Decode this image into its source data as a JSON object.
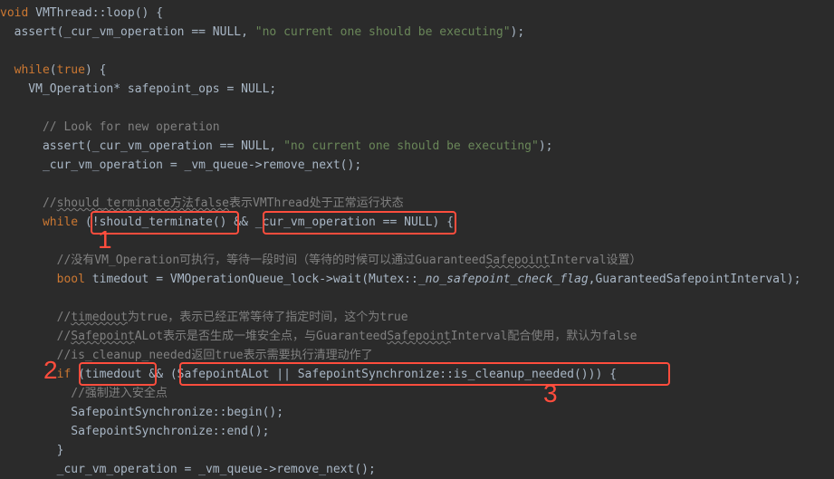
{
  "code": {
    "l0_void": "void",
    "l0_sig": " VMThread::loop() {",
    "l1_a": "  assert(_cur_vm_operation == NULL, ",
    "l1_str": "\"no current one should be executing\"",
    "l1_b": ");",
    "l2": "",
    "l3_while": "while",
    "l3_rest": "(",
    "l3_true": "true",
    "l3_end": ") {",
    "l4_a": "    VM_Operation* ",
    "l4_b": "safepoint_ops",
    "l4_c": " = NULL;",
    "l5": "",
    "l6_cm": "      // Look for new operation",
    "l7_a": "      assert(_cur_vm_operation == NULL, ",
    "l7_str": "\"no current one should be executing\"",
    "l7_b": ");",
    "l8": "      _cur_vm_operation = _vm_queue->remove_next();",
    "l9": "",
    "l10_cm_a": "      //",
    "l10_cm_us": "should_terminate方法false",
    "l10_cm_b": "表示VMThread处于正常运行状态",
    "l11_while": "while",
    "l11_a": " (!should_terminate() && _cur_vm_operation == NULL) {",
    "l12": "",
    "l13_cm": "        //没有VM_Operation可执行，等待一段时间（等待的时候可以通过Guaranteed",
    "l13_cm_us": "Safepoint",
    "l13_cm_b": "Interval设置）",
    "l14_bool": "bool",
    "l14_a": " ",
    "l14_v": "timedout",
    "l14_b": " = VMOperationQueue_lock->wait(Mutex::",
    "l14_i": "_no_safepoint_check_flag",
    "l14_c": ",GuaranteedSafepointInterval);",
    "l15": "",
    "l16_cm_a": "        //",
    "l16_cm_us": "timedout",
    "l16_cm_b": "为true，表示已经正常等待了指定时间，这个为true",
    "l17_cm_a": "        //",
    "l17_cm_us1": "Safepoint",
    "l17_cm_mid": "ALot表示是否生成一堆安全点，与Guaranteed",
    "l17_cm_us2": "Safepoint",
    "l17_cm_b": "Interval配合使用，默认为false",
    "l18_cm": "        //is_cleanup_needed返回true表示需要执行清理动作了",
    "l19_if": "if",
    "l19_a": " (timedout && (SafepointALot || SafepointSynchronize::is_cleanup_needed())) {",
    "l20_cm": "          //强制进入安全点",
    "l21": "          SafepointSynchronize::begin();",
    "l22": "          SafepointSynchronize::end();",
    "l23": "        }",
    "l24": "        _cur_vm_operation = _vm_queue->remove_next();"
  },
  "annotations": {
    "n1": "1",
    "n2": "2",
    "n3": "3"
  }
}
